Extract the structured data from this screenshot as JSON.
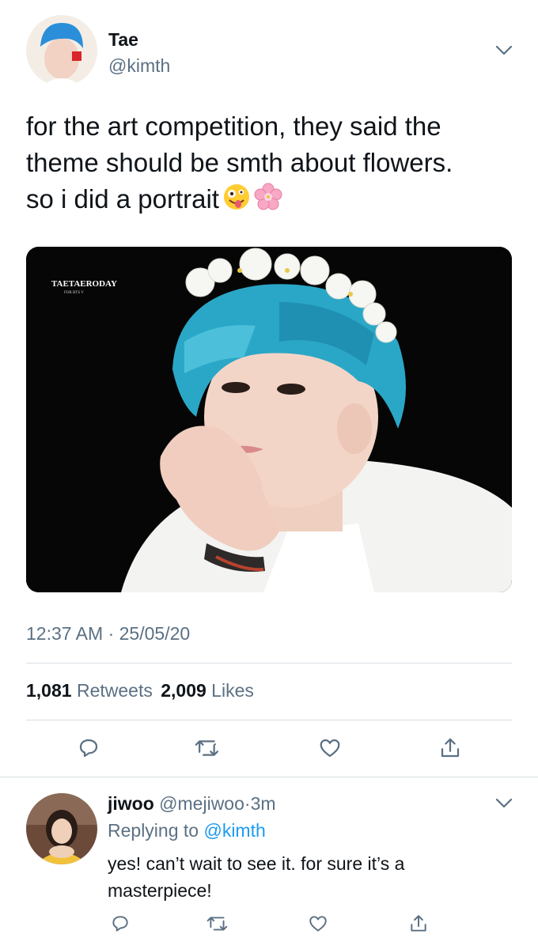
{
  "tweet": {
    "author_name": "Tae",
    "author_handle": "@kimth",
    "text_lines": [
      "for the art competition, they said the",
      "theme should be smth about flowers.",
      "so i did a portrait"
    ],
    "text_emojis": [
      "zany-face-emoji",
      "cherry-blossom-emoji"
    ],
    "photo": {
      "watermark_title": "TAETAERODAY",
      "watermark_sub": "FOR BTS V"
    },
    "time": "12:37 AM",
    "separator": "·",
    "date": "25/05/20",
    "retweets_count": "1,081",
    "retweets_label": "Retweets",
    "likes_count": "2,009",
    "likes_label": "Likes"
  },
  "reply": {
    "author_name": "jiwoo",
    "author_handle": "@mejiwoo",
    "separator": "·",
    "age": "3m",
    "replying_label": "Replying to",
    "replying_handle": "@kimth",
    "text_lines": [
      "yes! can’t wait to see it. for sure it’s a",
      "masterpiece!"
    ]
  },
  "icons": [
    "chevron-down-icon",
    "reply-icon",
    "retweet-icon",
    "like-icon",
    "share-icon"
  ],
  "colors": {
    "text": "#0f1419",
    "secondary": "#5b7083",
    "link": "#1d9bf0",
    "divider": "#d9dfe3"
  }
}
